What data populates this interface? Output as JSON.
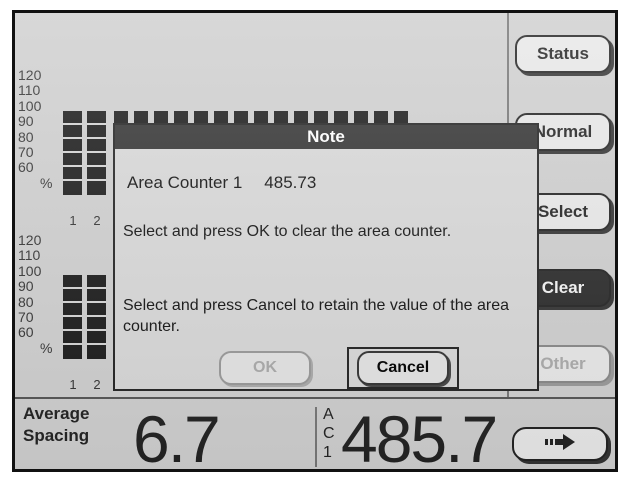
{
  "left_panel": {
    "top_axis": [
      "120",
      "110",
      "100",
      "90",
      "80",
      "70",
      "60",
      "%"
    ],
    "bottom_axis": [
      "120",
      "110",
      "100",
      "90",
      "80",
      "70",
      "60",
      "%"
    ],
    "column_numbers": [
      "1",
      "2"
    ]
  },
  "right_buttons": {
    "status": "Status",
    "normal": "Normal",
    "select": "Select",
    "clear": "Clear",
    "other": "Other"
  },
  "dialog": {
    "title": "Note",
    "counter_label": "Area Counter 1",
    "counter_value": "485.73",
    "message_ok": "Select and press OK to clear the area counter.",
    "message_cancel": "Select and press Cancel to retain the value of the area counter.",
    "ok_label": "OK",
    "cancel_label": "Cancel"
  },
  "bottom": {
    "avg_label_line1": "Average",
    "avg_label_line2": "Spacing",
    "avg_value": "6.7",
    "ac_letters": [
      "A",
      "C",
      "1"
    ],
    "ac_value": "485.7",
    "next_icon": "arrow-right-icon"
  }
}
